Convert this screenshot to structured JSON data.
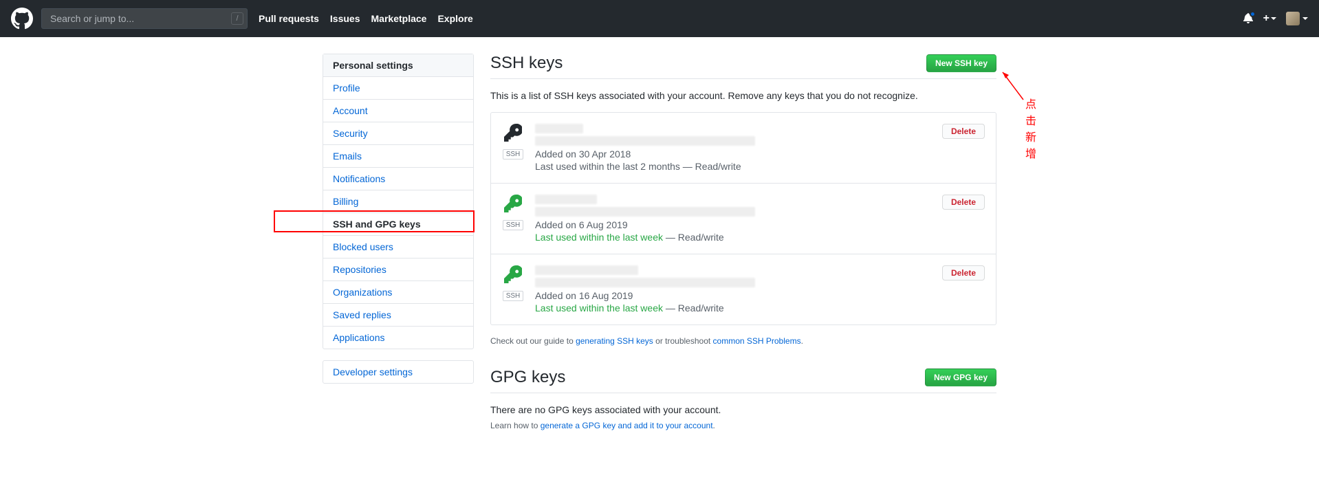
{
  "header": {
    "search_placeholder": "Search or jump to...",
    "nav": [
      "Pull requests",
      "Issues",
      "Marketplace",
      "Explore"
    ]
  },
  "sidebar": {
    "title": "Personal settings",
    "items": [
      "Profile",
      "Account",
      "Security",
      "Emails",
      "Notifications",
      "Billing",
      "SSH and GPG keys",
      "Blocked users",
      "Repositories",
      "Organizations",
      "Saved replies",
      "Applications"
    ],
    "selected_index": 6,
    "dev_settings": "Developer settings"
  },
  "ssh": {
    "title": "SSH keys",
    "new_btn": "New SSH key",
    "desc": "This is a list of SSH keys associated with your account. Remove any keys that you do not recognize.",
    "keys": [
      {
        "color": "black",
        "added": "Added on 30 Apr 2018",
        "last_prefix": "Last used within the last 2 months",
        "last_suffix": " — Read/write",
        "green_last": false
      },
      {
        "color": "green",
        "added": "Added on 6 Aug 2019",
        "last_prefix": "Last used within the last week",
        "last_suffix": " — Read/write",
        "green_last": true
      },
      {
        "color": "green",
        "added": "Added on 16 Aug 2019",
        "last_prefix": "Last used within the last week",
        "last_suffix": " — Read/write",
        "green_last": true
      }
    ],
    "delete": "Delete",
    "badge": "SSH",
    "footnote_pre": "Check out our guide to ",
    "footnote_link1": "generating SSH keys",
    "footnote_mid": " or troubleshoot ",
    "footnote_link2": "common SSH Problems",
    "footnote_post": "."
  },
  "gpg": {
    "title": "GPG keys",
    "new_btn": "New GPG key",
    "desc": "There are no GPG keys associated with your account.",
    "learn_pre": "Learn how to ",
    "learn_link": "generate a GPG key and add it to your account",
    "learn_post": "."
  },
  "annotation": {
    "text": "点击新增"
  }
}
